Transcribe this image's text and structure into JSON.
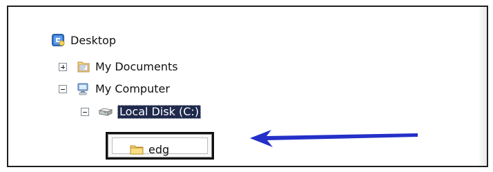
{
  "tree": {
    "desktop": {
      "label": "Desktop",
      "icon": "desktop-icon"
    },
    "my_documents": {
      "label": "My Documents",
      "icon": "my-documents-icon",
      "expander": "plus"
    },
    "my_computer": {
      "label": "My Computer",
      "icon": "my-computer-icon",
      "expander": "minus"
    },
    "local_disk": {
      "label": "Local Disk (C:)",
      "icon": "local-disk-icon",
      "expander": "minus",
      "selected": true
    },
    "edg": {
      "label": "edg",
      "icon": "folder-icon"
    }
  },
  "colors": {
    "selection_background": "#1f2a4d",
    "arrow": "#2430c8",
    "frame_border": "#1f1f1f"
  },
  "annotations": {
    "arrow_icon": "left-arrow-icon"
  }
}
